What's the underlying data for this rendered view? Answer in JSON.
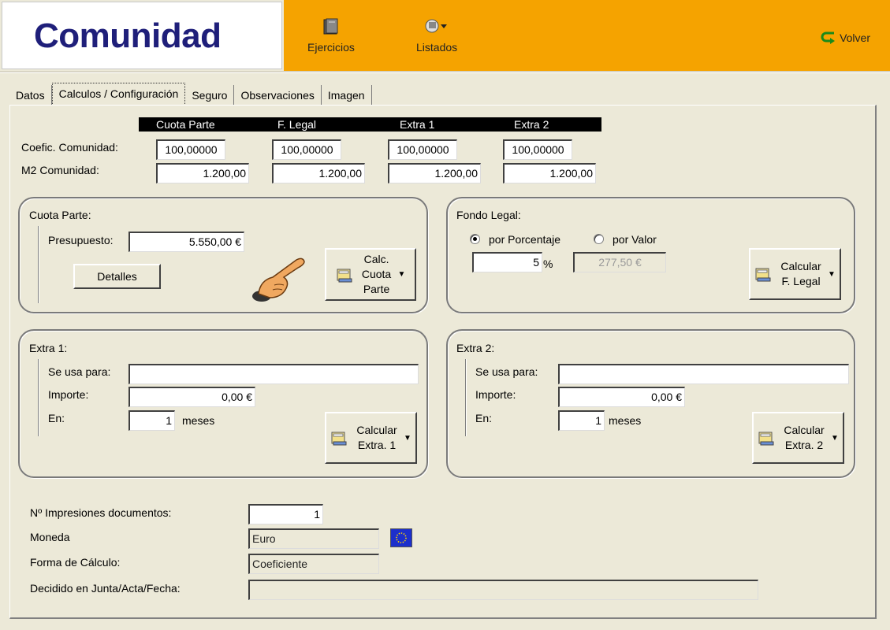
{
  "header": {
    "logo": "Comunidad",
    "toolbar": [
      {
        "label": "Ejercicios"
      },
      {
        "label": "Listados"
      }
    ],
    "volver": "Volver"
  },
  "tabs": [
    "Datos",
    "Calculos / Configuración",
    "Seguro",
    "Observaciones",
    "Imagen"
  ],
  "active_tab": "Calculos / Configuración",
  "columns": [
    "Cuota Parte",
    "F. Legal",
    "Extra 1",
    "Extra 2"
  ],
  "coef_label": "Coefic. Comunidad:",
  "coef_values": [
    "100,00000",
    "100,00000",
    "100,00000",
    "100,00000"
  ],
  "m2_label": "M2 Comunidad:",
  "m2_values": [
    "1.200,00",
    "1.200,00",
    "1.200,00",
    "1.200,00"
  ],
  "cuota_parte": {
    "title": "Cuota Parte:",
    "presupuesto_label": "Presupuesto:",
    "presupuesto_value": "5.550,00 €",
    "detalles_button": "Detalles",
    "calc_button": "Calc. Cuota Parte"
  },
  "fondo_legal": {
    "title": "Fondo Legal:",
    "opt_porcentaje": "por Porcentaje",
    "opt_valor": "por Valor",
    "selected": "por Porcentaje",
    "porcentaje_value": "5",
    "percent_sign": "%",
    "valor_value": "277,50 €",
    "calc_button": "Calcular F. Legal"
  },
  "extra1": {
    "title": "Extra 1:",
    "usa_label": "Se usa para:",
    "usa_value": "",
    "importe_label": "Importe:",
    "importe_value": "0,00 €",
    "en_label": "En:",
    "en_value": "1",
    "meses": "meses",
    "calc_button": "Calcular Extra. 1"
  },
  "extra2": {
    "title": "Extra 2:",
    "usa_label": "Se usa para:",
    "usa_value": "",
    "importe_label": "Importe:",
    "importe_value": "0,00 €",
    "en_label": "En:",
    "en_value": "1",
    "meses": "meses",
    "calc_button": "Calcular Extra. 2"
  },
  "bottom": {
    "impresiones_label": "Nº Impresiones documentos:",
    "impresiones_value": "1",
    "moneda_label": "Moneda",
    "moneda_value": "Euro",
    "forma_label": "Forma de Cálculo:",
    "forma_value": "Coeficiente",
    "decidido_label": "Decidido en Junta/Acta/Fecha:",
    "decidido_value": ""
  },
  "colors": {
    "toolbar": "#f5a300",
    "logo_text": "#1f1f7a",
    "eu_flag": "#1c2fcc"
  }
}
